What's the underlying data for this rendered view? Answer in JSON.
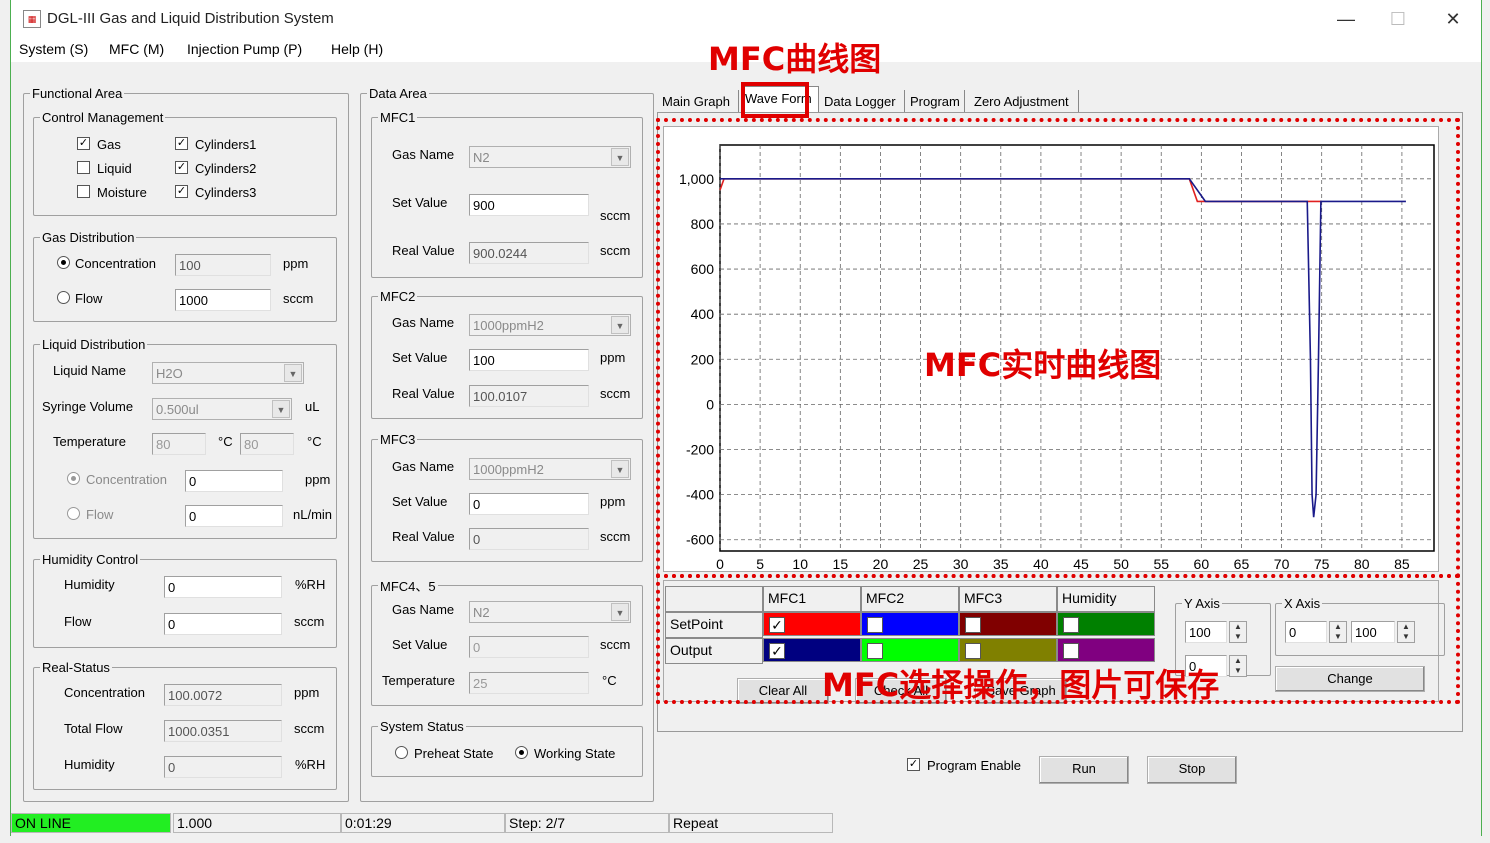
{
  "window": {
    "title": "DGL-III Gas and Liquid Distribution System",
    "controls": [
      "—",
      "☐",
      "✕"
    ]
  },
  "menu": [
    "System (S)",
    "MFC (M)",
    "Injection Pump (P)",
    "Help (H)"
  ],
  "functional": {
    "legend": "Functional Area",
    "control": {
      "legend": "Control Management",
      "items": [
        {
          "label": "Gas",
          "checked": true
        },
        {
          "label": "Liquid",
          "checked": false
        },
        {
          "label": "Moisture",
          "checked": false
        },
        {
          "label": "Cylinders1",
          "checked": true
        },
        {
          "label": "Cylinders2",
          "checked": true
        },
        {
          "label": "Cylinders3",
          "checked": true
        }
      ]
    },
    "gas": {
      "legend": "Gas Distribution",
      "conc_label": "Concentration",
      "conc_value": "100",
      "conc_unit": "ppm",
      "flow_label": "Flow",
      "flow_value": "1000",
      "flow_unit": "sccm"
    },
    "liquid": {
      "legend": "Liquid Distribution",
      "name_label": "Liquid Name",
      "name_value": "H2O",
      "syringe_label": "Syringe Volume",
      "syringe_value": "0.500ul",
      "syringe_unit": "uL",
      "temp_label": "Temperature",
      "temp_value1": "80",
      "temp_unit1": "°C",
      "temp_value2": "80",
      "temp_unit2": "°C",
      "conc_label": "Concentration",
      "conc_value": "0",
      "conc_unit": "ppm",
      "flow_label": "Flow",
      "flow_value": "0",
      "flow_unit": "nL/min"
    },
    "humidity": {
      "legend": "Humidity Control",
      "hum_label": "Humidity",
      "hum_value": "0",
      "hum_unit": "%RH",
      "flow_label": "Flow",
      "flow_value": "0",
      "flow_unit": "sccm"
    },
    "real": {
      "legend": "Real-Status",
      "conc_label": "Concentration",
      "conc_value": "100.0072",
      "conc_unit": "ppm",
      "flow_label": "Total Flow",
      "flow_value": "1000.0351",
      "flow_unit": "sccm",
      "hum_label": "Humidity",
      "hum_value": "0",
      "hum_unit": "%RH"
    }
  },
  "data_area": {
    "legend": "Data Area",
    "mfc1": {
      "legend": "MFC1",
      "gas_label": "Gas Name",
      "gas": "N2",
      "set_label": "Set Value",
      "set": "900",
      "set_unit": "sccm",
      "real_label": "Real Value",
      "real": "900.0244",
      "real_unit": "sccm"
    },
    "mfc2": {
      "legend": "MFC2",
      "gas_label": "Gas Name",
      "gas": "1000ppmH2",
      "set_label": "Set Value",
      "set": "100",
      "set_unit": "ppm",
      "real_label": "Real Value",
      "real": "100.0107",
      "real_unit": "sccm"
    },
    "mfc3": {
      "legend": "MFC3",
      "gas_label": "Gas Name",
      "gas": "1000ppmH2",
      "set_label": "Set Value",
      "set": "0",
      "set_unit": "ppm",
      "real_label": "Real Value",
      "real": "0",
      "real_unit": "sccm"
    },
    "mfc45": {
      "legend": "MFC4、5",
      "gas_label": "Gas Name",
      "gas": "N2",
      "set_label": "Set Value",
      "set": "0",
      "set_unit": "sccm",
      "temp_label": "Temperature",
      "temp": "25",
      "temp_unit": "°C"
    },
    "system": {
      "legend": "System Status",
      "preheat": "Preheat State",
      "working": "Working State"
    }
  },
  "tabs": [
    "Main Graph",
    "Wave Form",
    "Data Logger",
    "Program",
    "Zero Adjustment"
  ],
  "annotations": {
    "top": "MFC曲线图",
    "middle": "MFC实时曲线图",
    "bottom": "MFC选择操作，图片可保存"
  },
  "chart_data": {
    "type": "line",
    "title": "",
    "xlabel": "",
    "ylabel": "",
    "xlim": [
      0,
      89
    ],
    "ylim": [
      -650,
      1150
    ],
    "xticks": [
      0,
      5,
      10,
      15,
      20,
      25,
      30,
      35,
      40,
      45,
      50,
      55,
      60,
      65,
      70,
      75,
      80,
      85
    ],
    "yticks": [
      1000,
      800,
      600,
      400,
      200,
      0,
      -200,
      -400,
      -600
    ],
    "ytick_labels": [
      "1,000",
      "800",
      "600",
      "400",
      "200",
      "0",
      "-200",
      "-400",
      "-600"
    ],
    "grid": true,
    "series": [
      {
        "color": "#e02020",
        "x": [
          0,
          0.5,
          58.5,
          59.5,
          60.5,
          73,
          75
        ],
        "y": [
          950,
          1000,
          1000,
          900,
          900,
          900,
          900
        ]
      },
      {
        "color": "#1a1a8a",
        "x": [
          0,
          58.5,
          60.5,
          73.2,
          73.6,
          73.8,
          74.0,
          74.3,
          74.6,
          74.9,
          85.5
        ],
        "y": [
          1000,
          1000,
          900,
          900,
          200,
          -400,
          -500,
          -400,
          200,
          900,
          900
        ]
      }
    ]
  },
  "legend_grid": {
    "headers": [
      "MFC1",
      "MFC2",
      "MFC3",
      "Humidity"
    ],
    "rows": [
      "SetPoint",
      "Output"
    ],
    "setpoint_colors": [
      "#ff0000",
      "#0000ff",
      "#800000",
      "#008000"
    ],
    "output_colors": [
      "#000080",
      "#00ff00",
      "#808000",
      "#800080"
    ],
    "setpoint_checked": [
      true,
      false,
      false,
      false
    ],
    "output_checked": [
      true,
      false,
      false,
      false
    ],
    "clear_label": "Clear All",
    "check_label": "Check All",
    "save_label": "Save Graph",
    "yaxis_legend": "Y Axis",
    "yaxis_max": "100",
    "yaxis_min": "0",
    "xaxis_legend": "X Axis",
    "xaxis_from": "0",
    "xaxis_to": "100",
    "change_label": "Change"
  },
  "program": {
    "enable_label": "Program Enable",
    "run_label": "Run",
    "stop_label": "Stop"
  },
  "status": {
    "online": "ON LINE",
    "value": "1.000",
    "time": "0:01:29",
    "step": "Step: 2/7",
    "mode": "Repeat",
    "online_color": "#22ee22"
  }
}
